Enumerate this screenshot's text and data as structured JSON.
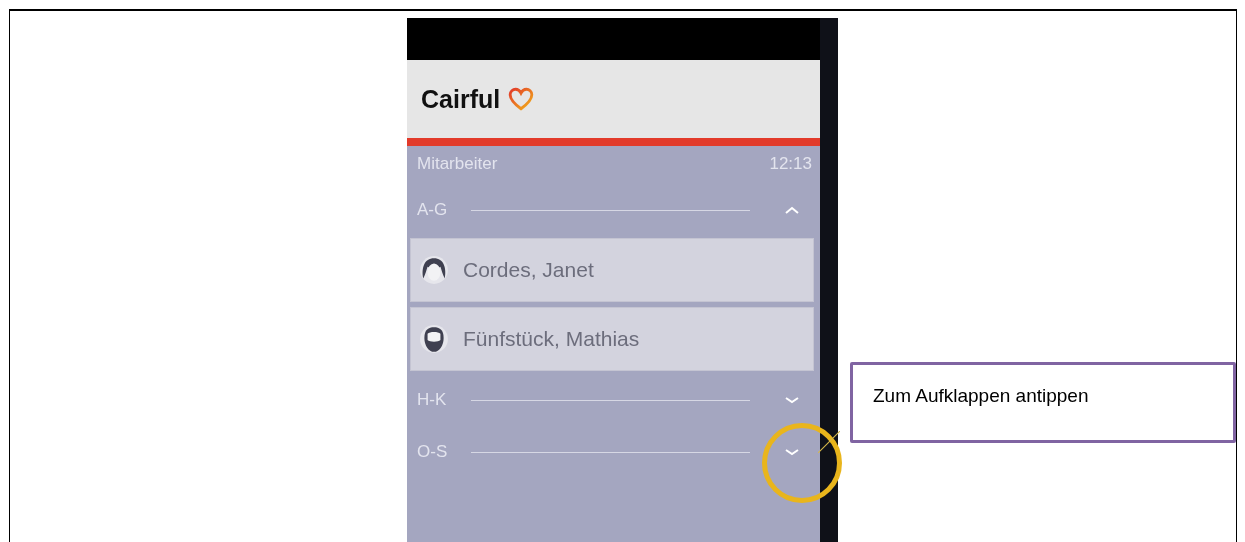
{
  "app": {
    "title": "Cairful"
  },
  "subheader": {
    "title": "Mitarbeiter",
    "time": "12:13"
  },
  "groups": [
    {
      "label": "A-G",
      "expanded": true,
      "members": [
        {
          "name": "Cordes, Janet",
          "kind": "female"
        },
        {
          "name": "Fünfstück, Mathias",
          "kind": "male"
        }
      ]
    },
    {
      "label": "H-K",
      "expanded": false
    },
    {
      "label": "O-S",
      "expanded": false,
      "highlighted": true
    }
  ],
  "callout": {
    "text": "Zum Aufklappen antippen"
  }
}
